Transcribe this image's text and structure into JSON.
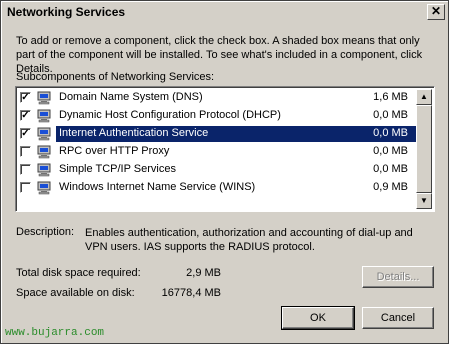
{
  "window": {
    "title": "Networking Services",
    "close_glyph": "✕"
  },
  "intro": "To add or remove a component, click the check box. A shaded box means that only part of the component will be installed. To see what's included in a component, click Details.",
  "subcomponents_label": "Subcomponents of Networking Services:",
  "components": [
    {
      "name": "Domain Name System (DNS)",
      "size": "1,6 MB",
      "checked": true,
      "selected": false
    },
    {
      "name": "Dynamic Host Configuration Protocol (DHCP)",
      "size": "0,0 MB",
      "checked": true,
      "selected": false
    },
    {
      "name": "Internet Authentication Service",
      "size": "0,0 MB",
      "checked": true,
      "selected": true
    },
    {
      "name": "RPC over HTTP Proxy",
      "size": "0,0 MB",
      "checked": false,
      "selected": false
    },
    {
      "name": "Simple TCP/IP Services",
      "size": "0,0 MB",
      "checked": false,
      "selected": false
    },
    {
      "name": "Windows Internet Name Service (WINS)",
      "size": "0,9 MB",
      "checked": false,
      "selected": false
    }
  ],
  "description": {
    "label": "Description:",
    "text": "Enables authentication, authorization and accounting of dial-up and VPN users. IAS supports the RADIUS protocol."
  },
  "disk": {
    "required_label": "Total disk space required:",
    "required_value": "2,9 MB",
    "available_label": "Space available on disk:",
    "available_value": "16778,4 MB"
  },
  "buttons": {
    "details": "Details...",
    "ok": "OK",
    "cancel": "Cancel"
  },
  "watermark": "www.bujarra.com",
  "colors": {
    "dialog": "#d4d0c8",
    "selection": "#0a246a",
    "watermark": "#2a8c2a"
  }
}
